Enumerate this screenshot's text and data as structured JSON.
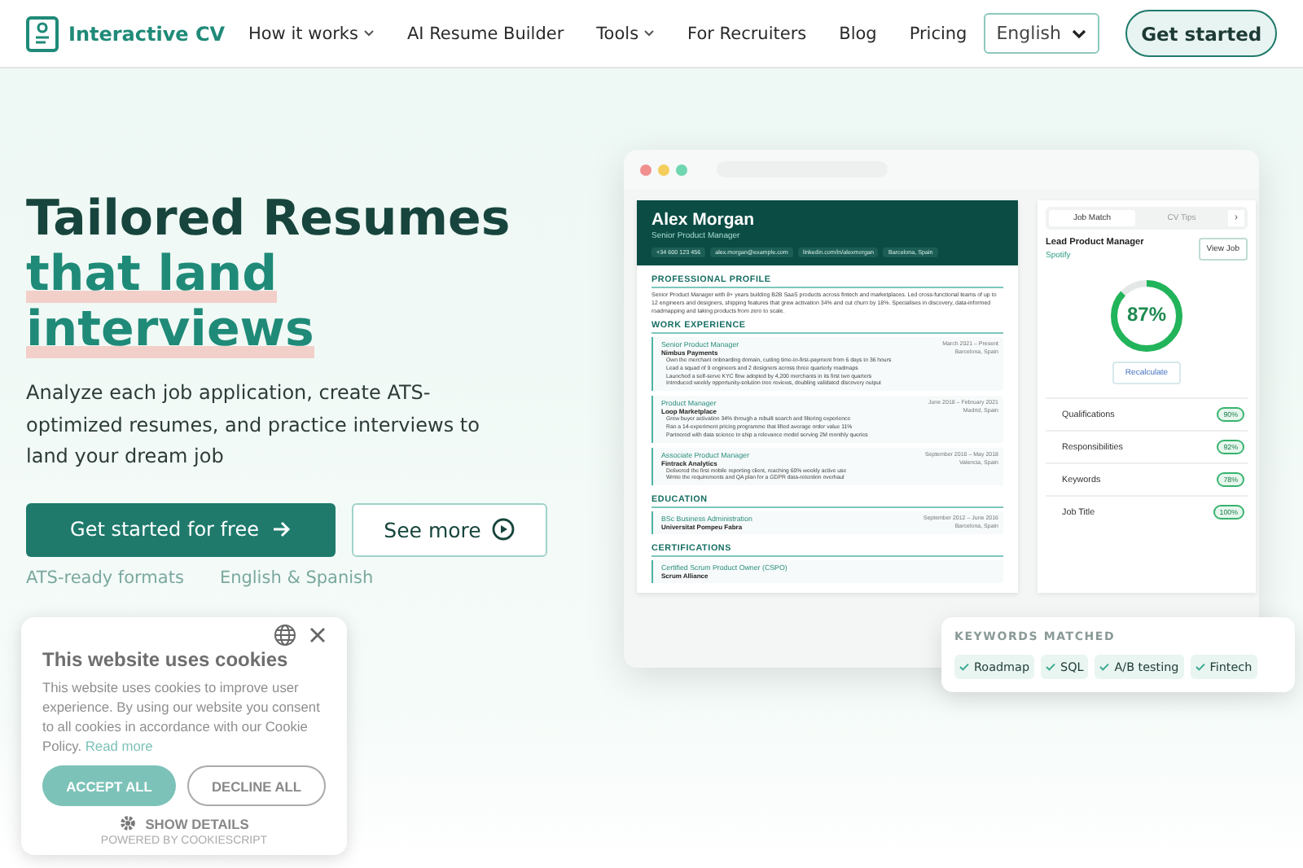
{
  "nav": {
    "brand": "Interactive CV",
    "links": [
      {
        "label": "How it works",
        "dropdown": true
      },
      {
        "label": "AI Resume Builder",
        "dropdown": false
      },
      {
        "label": "Tools",
        "dropdown": true
      },
      {
        "label": "For Recruiters",
        "dropdown": false
      },
      {
        "label": "Blog",
        "dropdown": false
      },
      {
        "label": "Pricing",
        "dropdown": false
      }
    ],
    "language": "English",
    "cta": "Get started"
  },
  "hero": {
    "title_line1": "Tailored Resumes",
    "title_accent": [
      "that land",
      "interviews"
    ],
    "subtitle": "Analyze each job application, create ATS-optimized resumes, and practice interviews to land your dream job",
    "primary": "Get started for free",
    "secondary": "See more",
    "features": [
      "ATS-ready formats",
      "English & Spanish"
    ]
  },
  "resume": {
    "name": "Alex Morgan",
    "role": "Senior Product Manager",
    "contacts": [
      "+34 600 123 456",
      "alex.morgan@example.com",
      "linkedin.com/in/alexmorgan",
      "Barcelona, Spain"
    ],
    "profile_heading": "PROFESSIONAL PROFILE",
    "profile": "Senior Product Manager with 8+ years building B2B SaaS products across fintech and marketplaces. Led cross-functional teams of up to 12 engineers and designers, shipping features that grew activation 34% and cut churn by 18%. Specialises in discovery, data-informed roadmapping and taking products from zero to scale.",
    "experience_heading": "WORK EXPERIENCE",
    "jobs": [
      {
        "title": "Senior Product Manager",
        "company": "Nimbus Payments",
        "dates": "March 2021 – Present",
        "location": "Barcelona, Spain",
        "bullets": [
          "Own the merchant onboarding domain, cutting time-to-first-payment from 6 days to 36 hours",
          "Lead a squad of 9 engineers and 2 designers across three quarterly roadmaps",
          "Launched a self-serve KYC flow adopted by 4,200 merchants in its first two quarters",
          "Introduced weekly opportunity-solution tree reviews, doubling validated discovery output"
        ]
      },
      {
        "title": "Product Manager",
        "company": "Loop Marketplace",
        "dates": "June 2018 – February 2021",
        "location": "Madrid, Spain",
        "bullets": [
          "Grew buyer activation 34% through a rebuilt search and filtering experience",
          "Ran a 14-experiment pricing programme that lifted average order value 11%",
          "Partnered with data science to ship a relevance model serving 2M monthly queries"
        ]
      },
      {
        "title": "Associate Product Manager",
        "company": "Fintrack Analytics",
        "dates": "September 2016 – May 2018",
        "location": "Valencia, Spain",
        "bullets": [
          "Delivered the first mobile reporting client, reaching 60% weekly active use",
          "Wrote the requirements and QA plan for a GDPR data-retention overhaul"
        ]
      }
    ],
    "education_heading": "EDUCATION",
    "education": {
      "title": "BSc Business Administration",
      "school": "Universitat Pompeu Fabra",
      "dates": "September 2012 – June 2016",
      "location": "Barcelona, Spain"
    },
    "certifications_heading": "CERTIFICATIONS",
    "certification": {
      "title": "Certified Scrum Product Owner (CSPO)",
      "issuer": "Scrum Alliance"
    }
  },
  "panel": {
    "tabs": [
      {
        "label": "Job Match",
        "selected": true
      },
      {
        "label": "CV Tips",
        "selected": false
      }
    ],
    "next": "›",
    "job": "Lead Product Manager",
    "company": "Spotify",
    "view_job": "View Job",
    "score": "87%",
    "level": 0.87,
    "recalculate": "Recalculate",
    "rows": [
      {
        "label": "Qualifications",
        "value": "90%"
      },
      {
        "label": "Responsibilities",
        "value": "92%"
      },
      {
        "label": "Keywords",
        "value": "78%"
      },
      {
        "label": "Job Title",
        "value": "100%"
      }
    ]
  },
  "keywords": {
    "heading": "KEYWORDS MATCHED",
    "items": [
      "Roadmap",
      "SQL",
      "A/B testing",
      "Fintech"
    ]
  },
  "cookie": {
    "title": "This website uses cookies",
    "text": "This website uses cookies to improve user experience. By using our website you consent to all cookies in accordance with our Cookie Policy.",
    "link": "Read more",
    "accept": "ACCEPT ALL",
    "decline": "DECLINE ALL",
    "details": "SHOW DETAILS",
    "powered": "POWERED BY COOKIESCRIPT"
  }
}
